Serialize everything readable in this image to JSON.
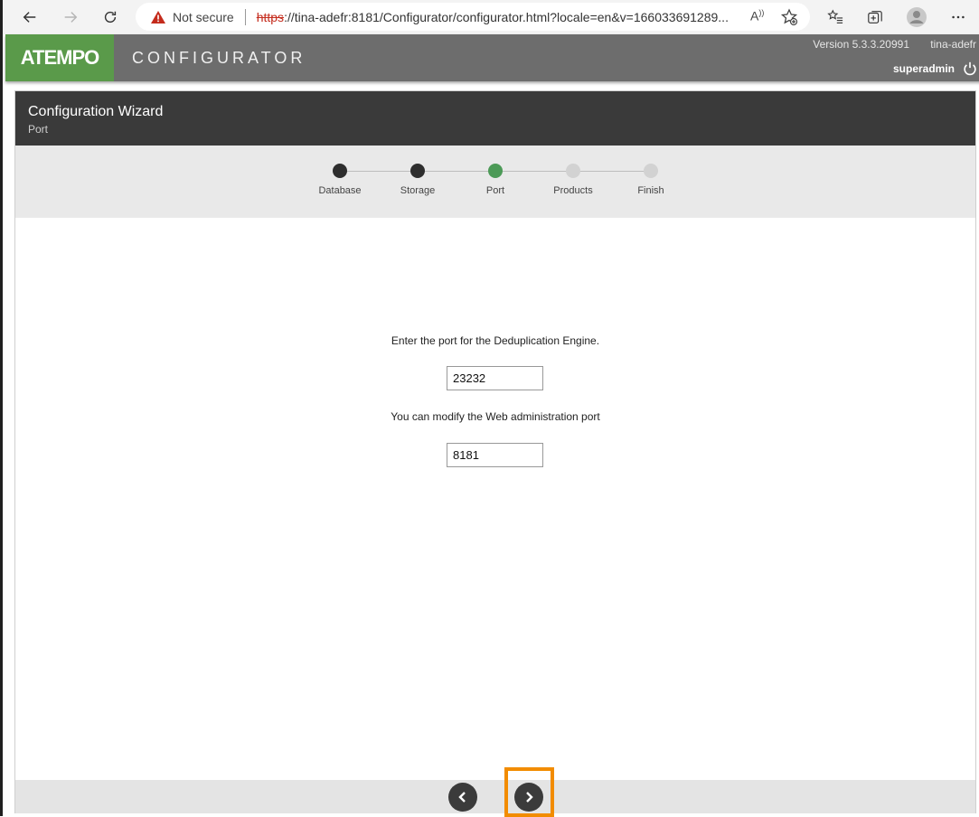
{
  "browser": {
    "security_label": "Not secure",
    "url_scheme": "https",
    "url_rest": "://tina-adefr:8181/Configurator/configurator.html?locale=en&v=166033691289..."
  },
  "header": {
    "logo": "ATEMPO",
    "title": "CONFIGURATOR",
    "version": "Version 5.3.3.20991",
    "host": "tina-adefr",
    "user": "superadmin"
  },
  "wizard": {
    "title": "Configuration Wizard",
    "subtitle": "Port",
    "steps": [
      {
        "label": "Database",
        "state": "done"
      },
      {
        "label": "Storage",
        "state": "done"
      },
      {
        "label": "Port",
        "state": "current"
      },
      {
        "label": "Products",
        "state": "todo"
      },
      {
        "label": "Finish",
        "state": "todo"
      }
    ],
    "dedup_prompt": "Enter the port for the Deduplication Engine.",
    "dedup_port": "23232",
    "web_prompt": "You can modify the Web administration port",
    "web_port": "8181"
  },
  "colors": {
    "accent_green": "#4c9a57",
    "highlight_orange": "#f28c00"
  }
}
